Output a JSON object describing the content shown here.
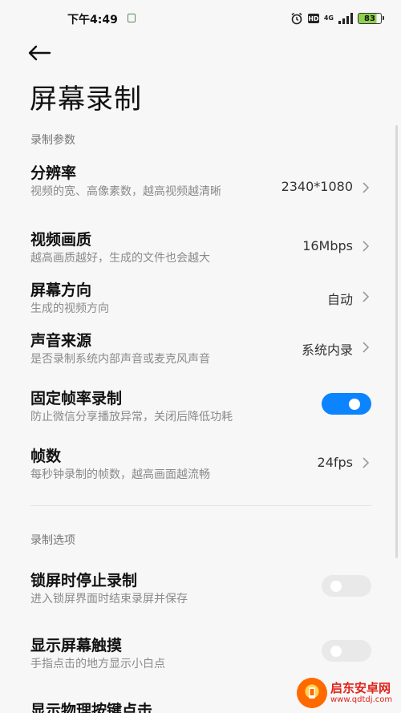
{
  "status_bar": {
    "time": "下午4:49",
    "hd_label": "HD",
    "network_label": "4G",
    "battery_level": "83",
    "icons": [
      "notification-icon",
      "alarm-icon",
      "hd-icon",
      "signal-icon",
      "battery-icon"
    ]
  },
  "header": {
    "back_icon": "arrow-left-icon",
    "title": "屏幕录制"
  },
  "sections": {
    "params_header": "录制参数",
    "options_header": "录制选项"
  },
  "params": {
    "resolution": {
      "title": "分辨率",
      "subtitle": "视频的宽、高像素数，越高视频越清晰",
      "value": "2340*1080"
    },
    "quality": {
      "title": "视频画质",
      "subtitle": "越高画质越好，生成的文件也会越大",
      "value": "16Mbps"
    },
    "orientation": {
      "title": "屏幕方向",
      "subtitle": "生成的视频方向",
      "value": "自动"
    },
    "audio_source": {
      "title": "声音来源",
      "subtitle": "是否录制系统内部声音或麦克风声音",
      "value": "系统内录"
    },
    "fixed_framerate": {
      "title": "固定帧率录制",
      "subtitle": "防止微信分享播放异常，关闭后降低功耗",
      "enabled": true
    },
    "framerate": {
      "title": "帧数",
      "subtitle": "每秒钟录制的帧数，越高画面越流畅",
      "value": "24fps"
    }
  },
  "options": {
    "stop_on_lock": {
      "title": "锁屏时停止录制",
      "subtitle": "进入锁屏界面时结束录屏并保存",
      "enabled": false
    },
    "show_touches": {
      "title": "显示屏幕触摸",
      "subtitle": "手指点击的地方显示小白点",
      "enabled": false
    },
    "show_key_presses": {
      "title": "显示物理按键点击"
    }
  },
  "watermark": {
    "name": "启东安卓网",
    "url": "www.qdtdj.com"
  },
  "colors": {
    "accent": "#0d84ff",
    "background": "#f7f7f7",
    "toggle_off": "#e9e9e9"
  }
}
